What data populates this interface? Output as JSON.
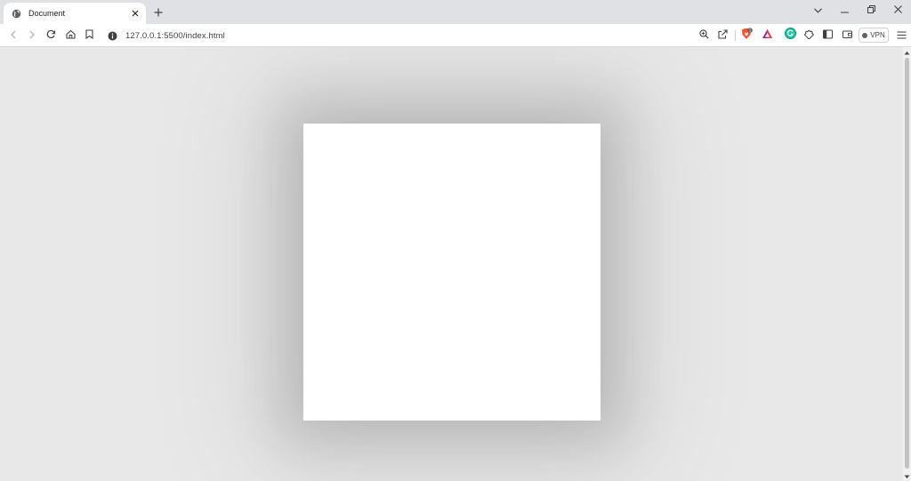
{
  "tab": {
    "title": "Document",
    "favicon": "globe-icon"
  },
  "toolbar": {
    "url": "127.0.0.1:5500/index.html",
    "vpn_label": "VPN"
  },
  "colors": {
    "page_background": "#e8e8e8",
    "content_box": "#ffffff",
    "brave_orange": "#fb542b",
    "grammarly_green": "#15c39a"
  },
  "icons": {
    "back": "arrow-left-icon",
    "forward": "arrow-right-icon",
    "reload": "reload-icon",
    "home": "home-icon",
    "bookmark": "bookmark-icon",
    "zoom": "zoom-icon",
    "share": "share-icon",
    "shields": "brave-shield-icon",
    "rewards": "brave-rewards-icon",
    "grammarly": "grammarly-icon",
    "extensions": "puzzle-icon",
    "sidebar": "sidebar-icon",
    "wallet": "wallet-icon",
    "menu": "hamburger-menu-icon"
  },
  "shields_badge": "1"
}
